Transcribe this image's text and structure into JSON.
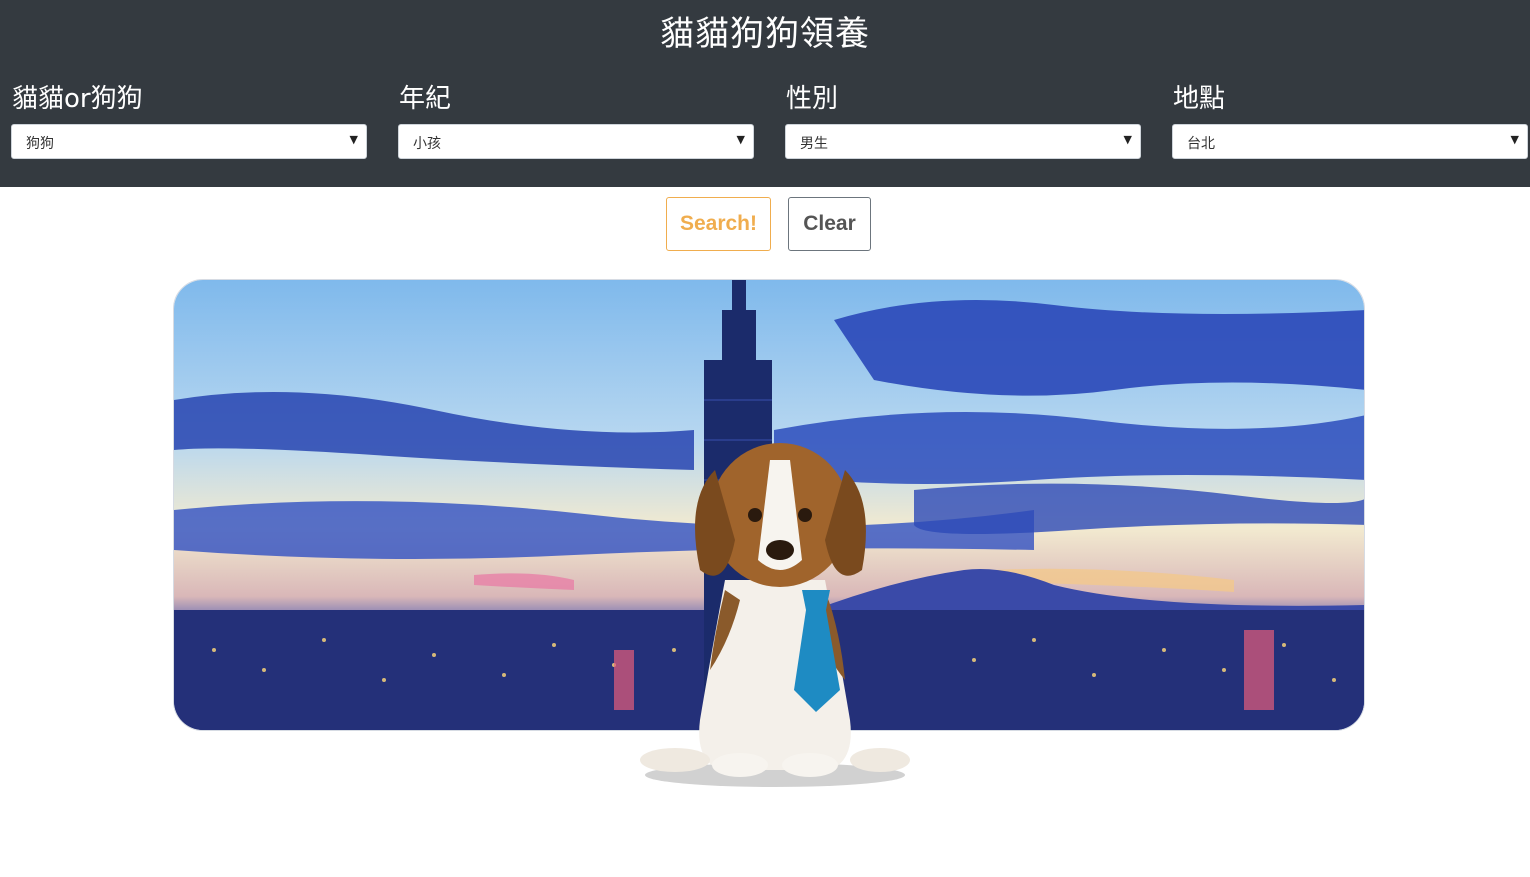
{
  "header": {
    "title": "貓貓狗狗領養"
  },
  "filters": [
    {
      "label": "貓貓or狗狗",
      "value": "狗狗"
    },
    {
      "label": "年紀",
      "value": "小孩"
    },
    {
      "label": "性別",
      "value": "男生"
    },
    {
      "label": "地點",
      "value": "台北"
    }
  ],
  "actions": {
    "search_label": "Search!",
    "clear_label": "Clear"
  },
  "colors": {
    "header_bg": "#343a40",
    "search_accent": "#f0ad4e",
    "clear_border": "#6c757d",
    "tie": "#1e8bc3"
  },
  "hero": {
    "icon": "taipei-skyline-puppy-image"
  }
}
